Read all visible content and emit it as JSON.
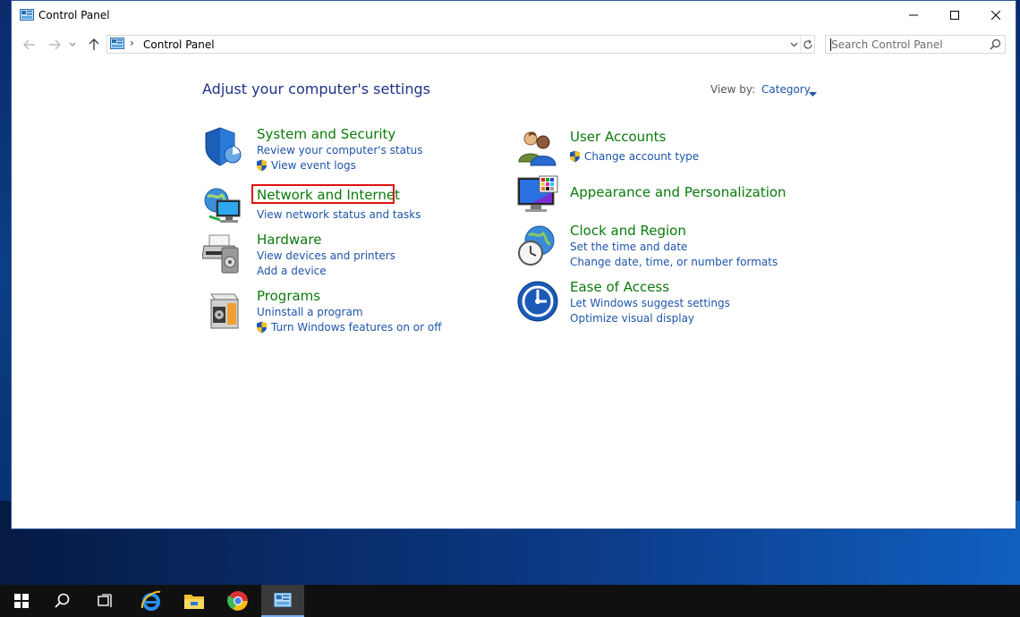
{
  "window": {
    "title": "Control Panel"
  },
  "navigation": {
    "breadcrumb_sep": "›",
    "address": "Control Panel",
    "search_placeholder": "Search Control Panel"
  },
  "main": {
    "heading": "Adjust your computer's settings",
    "view_by_label": "View by:",
    "view_by_value": "Category"
  },
  "categories_left": [
    {
      "title": "System and Security",
      "icon": "shield-security-icon",
      "links": [
        "Review your computer's status",
        "View event logs"
      ]
    },
    {
      "title": "Network and Internet",
      "icon": "network-globe-icon",
      "links": [
        "View network status and tasks"
      ]
    },
    {
      "title": "Hardware",
      "icon": "printer-hardware-icon",
      "links": [
        "View devices and printers",
        "Add a device"
      ]
    },
    {
      "title": "Programs",
      "icon": "programs-box-icon",
      "links": [
        "Uninstall a program",
        "Turn Windows features on or off"
      ]
    }
  ],
  "categories_right": [
    {
      "title": "User Accounts",
      "icon": "users-icon",
      "links": [
        "Change account type"
      ]
    },
    {
      "title": "Appearance and Personalization",
      "icon": "monitor-palette-icon",
      "links": []
    },
    {
      "title": "Clock and Region",
      "icon": "clock-globe-icon",
      "links": [
        "Set the time and date",
        "Change date, time, or number formats"
      ]
    },
    {
      "title": "Ease of Access",
      "icon": "ease-of-access-icon",
      "links": [
        "Let Windows suggest settings",
        "Optimize visual display"
      ]
    }
  ],
  "highlighted_item": "Network and Internet",
  "colors": {
    "category_title": "#0b7a0b",
    "link": "#1e55a8",
    "heading": "#1e3287",
    "highlight": "#e01010"
  },
  "taskbar": {
    "items": [
      "start-icon",
      "search-icon",
      "task-view-icon",
      "internet-explorer-icon",
      "file-explorer-icon",
      "chrome-icon",
      "control-panel-icon"
    ]
  }
}
